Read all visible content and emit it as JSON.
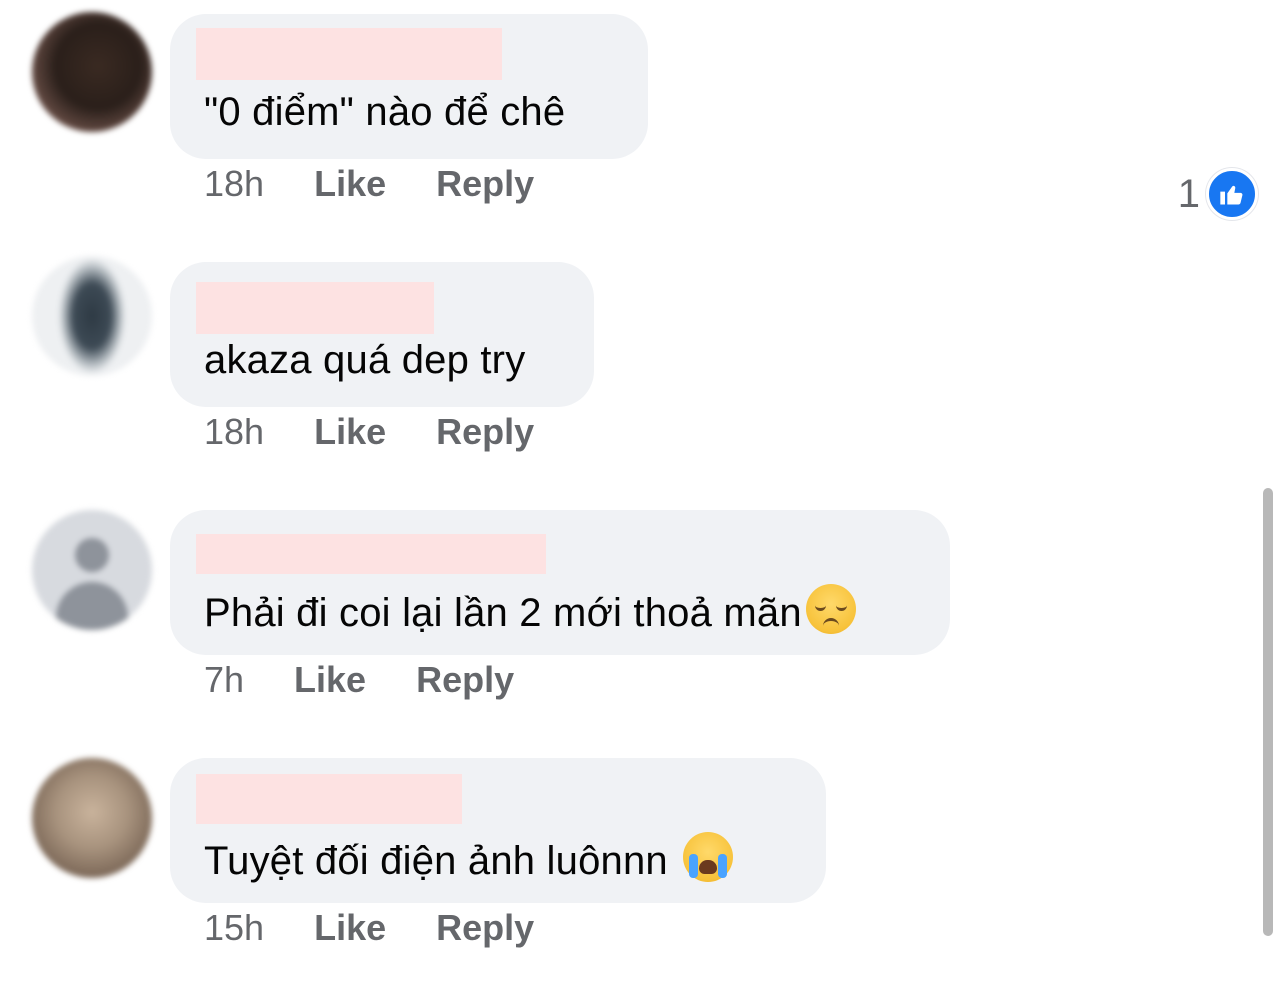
{
  "comments": [
    {
      "text": "\"0 điểm\" nào để chê",
      "time": "18h",
      "like_label": "Like",
      "reply_label": "Reply",
      "reaction_count": "1",
      "emoji": ""
    },
    {
      "text": "akaza quá dep try",
      "time": "18h",
      "like_label": "Like",
      "reply_label": "Reply",
      "emoji": ""
    },
    {
      "text": "Phải đi coi lại lần 2 mới thoả mãn",
      "time": "7h",
      "like_label": "Like",
      "reply_label": "Reply",
      "emoji": "pensive-face"
    },
    {
      "text": "Tuyệt đối điện ảnh luônnn",
      "time": "15h",
      "like_label": "Like",
      "reply_label": "Reply",
      "emoji": "loudly-crying-face"
    }
  ],
  "colors": {
    "bubble": "#f0f2f5",
    "meta_text": "#65676b",
    "like_blue": "#1877f2",
    "redaction": "#fde2e2"
  }
}
